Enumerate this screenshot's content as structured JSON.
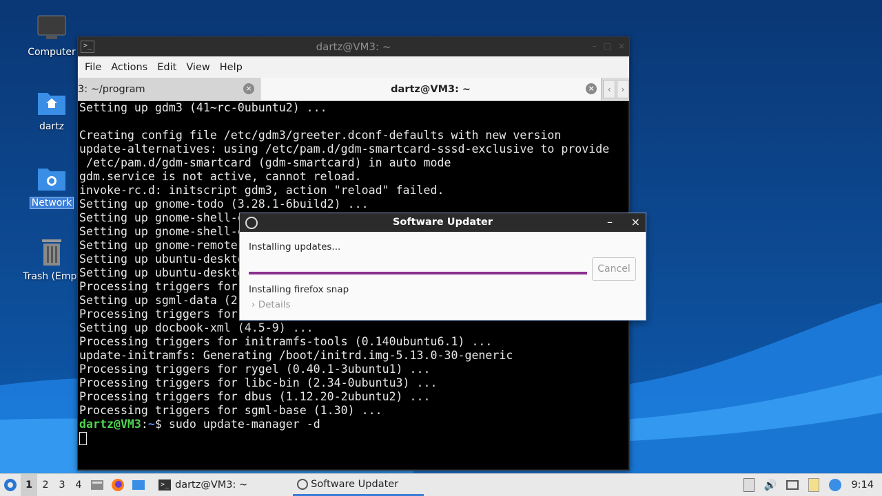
{
  "desktop": {
    "icons": [
      {
        "label": "Computer",
        "icon": "computer-icon"
      },
      {
        "label": "dartz",
        "icon": "home-folder-icon"
      },
      {
        "label": "Network",
        "icon": "network-folder-icon"
      },
      {
        "label": "Trash (Empt",
        "icon": "trash-icon"
      }
    ]
  },
  "terminal": {
    "title": "dartz@VM3: ~",
    "menu": [
      "File",
      "Actions",
      "Edit",
      "View",
      "Help"
    ],
    "tabs": [
      {
        "label": "3: ~/program"
      },
      {
        "label": "dartz@VM3: ~"
      }
    ],
    "lines": [
      "Setting up gdm3 (41~rc-0ubuntu2) ...",
      "",
      "Creating config file /etc/gdm3/greeter.dconf-defaults with new version",
      "update-alternatives: using /etc/pam.d/gdm-smartcard-sssd-exclusive to provide",
      " /etc/pam.d/gdm-smartcard (gdm-smartcard) in auto mode",
      "gdm.service is not active, cannot reload.",
      "invoke-rc.d: initscript gdm3, action \"reload\" failed.",
      "Setting up gnome-todo (3.28.1-6build2) ...",
      "Setting up gnome-shell-e",
      "Setting up gnome-shell-e",
      "Setting up gnome-remote",
      "Setting up ubuntu-deskto",
      "Setting up ubuntu-deskto",
      "Processing triggers for",
      "Setting up sgml-data (2",
      "Processing triggers for",
      "Setting up docbook-xml (4.5-9) ...",
      "Processing triggers for initramfs-tools (0.140ubuntu6.1) ...",
      "update-initramfs: Generating /boot/initrd.img-5.13.0-30-generic",
      "Processing triggers for rygel (0.40.1-3ubuntu1) ...",
      "Processing triggers for libc-bin (2.34-0ubuntu3) ...",
      "Processing triggers for dbus (1.12.20-2ubuntu2) ...",
      "Processing triggers for sgml-base (1.30) ..."
    ],
    "prompt": {
      "user": "dartz@VM3",
      "sep": ":",
      "path": "~",
      "symbol": "$",
      "command": " sudo update-manager -d"
    }
  },
  "dialog": {
    "title": "Software Updater",
    "status": "Installing updates...",
    "progress": 1.0,
    "cancel_label": "Cancel",
    "detail": "Installing firefox snap",
    "details_label": "Details",
    "minimize_glyph": "–",
    "close_glyph": "×",
    "accent": "#8c2f8e"
  },
  "taskbar": {
    "workspaces": [
      "1",
      "2",
      "3",
      "4"
    ],
    "current_workspace": "1",
    "tasks": [
      {
        "label": "dartz@VM3: ~",
        "icon": "terminal-icon"
      },
      {
        "label": "Software Updater",
        "icon": "software-updater-icon"
      }
    ],
    "clock": "9:14"
  }
}
